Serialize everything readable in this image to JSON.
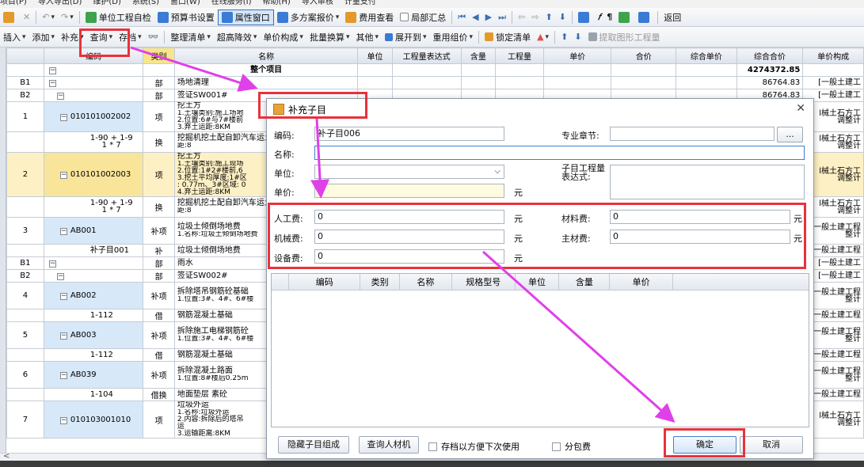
{
  "menubar": [
    "项目(P)",
    "导入导出(D)",
    "维护(D)",
    "系统(S)",
    "窗口(W)",
    "在线服务(I)",
    "帮助(H)",
    "导入审核",
    "计量支付"
  ],
  "toolbar1": [
    {
      "label": "单位工程自检",
      "icon": "check-icon"
    },
    {
      "label": "预算书设置",
      "icon": "settings-icon"
    },
    {
      "label": "属性窗口",
      "icon": "window-icon",
      "active": true
    },
    {
      "label": "多方案报价",
      "icon": "multi-plan-icon",
      "dropdown": true
    },
    {
      "label": "费用查看",
      "icon": "fee-view-icon"
    },
    {
      "label": "局部汇总",
      "icon": "checkbox-icon"
    },
    {
      "label": "返回",
      "icon": "back-icon"
    }
  ],
  "toolbar2": [
    {
      "label": "插入",
      "dropdown": true
    },
    {
      "label": "添加",
      "dropdown": true
    },
    {
      "label": "补充",
      "dropdown": true
    },
    {
      "label": "查询",
      "dropdown": true
    },
    {
      "label": "存档",
      "dropdown": true
    },
    {
      "label": "整理清单",
      "dropdown": true
    },
    {
      "label": "超高降效",
      "dropdown": true
    },
    {
      "label": "单价构成",
      "dropdown": true
    },
    {
      "label": "批量换算",
      "dropdown": true
    },
    {
      "label": "其他",
      "dropdown": true
    },
    {
      "label": "展开到",
      "dropdown": true
    },
    {
      "label": "重用组价",
      "dropdown": true
    },
    {
      "label": "锁定清单",
      "dropdown": false
    },
    {
      "label": "提取图形工程量",
      "dropdown": false
    }
  ],
  "grid": {
    "headers": [
      "编码",
      "类别",
      "名称",
      "单位",
      "工程量表达式",
      "含量",
      "工程量",
      "单价",
      "合价",
      "综合单价",
      "综合合价",
      "单价构成"
    ],
    "rows": [
      {
        "no": "",
        "code": "",
        "type": "",
        "name": "整个项目",
        "total": "4274372.85",
        "comp": "",
        "kind": "root"
      },
      {
        "no": "B1",
        "code": "",
        "type": "部",
        "name": "场地清理",
        "total": "86764.83",
        "comp": "[一般土建工",
        "kind": "part"
      },
      {
        "no": "B2",
        "code": "",
        "type": "部",
        "name": "签证SW001#",
        "total": "86764.83",
        "comp": "[一般土建工",
        "kind": "part"
      },
      {
        "no": "1",
        "code": "010101002002",
        "type": "项",
        "name": "挖土方",
        "desc": "1.土壤类别:施工场地\n2.位置:6#与7#楼前\n3.弃土运距:8KM",
        "total": "",
        "comp": "l械土石方工\n调整计",
        "kind": "item"
      },
      {
        "no": "",
        "code": "1-90 + 1-9\n1 * 7",
        "type": "换",
        "name": "挖掘机挖土配自卸汽车运土",
        "desc": "距:8",
        "total": "",
        "comp": "l械土石方工\n调整计",
        "kind": "sub"
      },
      {
        "no": "2",
        "code": "010101002003",
        "type": "项",
        "name": "挖土方",
        "desc": "1.土壤类别:施工现场\n2.位置:1#2#楼前,6\n3.挖土平均厚度:1#区\n: 0.77m、3#区域: 0\n4.弃土运距:8KM",
        "total": "",
        "comp": "l械土石方工\n调整计",
        "kind": "item-sel"
      },
      {
        "no": "",
        "code": "1-90 + 1-9\n1 * 7",
        "type": "换",
        "name": "挖掘机挖土配自卸汽车运土",
        "desc": "距:8",
        "total": "",
        "comp": "l械土石方工\n调整计",
        "kind": "sub"
      },
      {
        "no": "3",
        "code": "AB001",
        "type": "补项",
        "name": "垃圾土倾倒场地费",
        "desc": "1.名称:垃圾土倾倒场地费",
        "total": "",
        "comp": "一般土建工程\n整计",
        "kind": "item"
      },
      {
        "no": "",
        "code": "补子目001",
        "type": "补",
        "name": "垃圾土倾倒场地费",
        "desc": "",
        "total": "",
        "comp": "一般土建工程",
        "kind": "sub"
      },
      {
        "no": "B1",
        "code": "",
        "type": "部",
        "name": "雨水",
        "total": "",
        "comp": "[一般土建工",
        "kind": "part"
      },
      {
        "no": "B2",
        "code": "",
        "type": "部",
        "name": "签证SW002#",
        "total": "",
        "comp": "[一般土建工",
        "kind": "part"
      },
      {
        "no": "4",
        "code": "AB002",
        "type": "补项",
        "name": "拆除塔吊钢筋砼基础",
        "desc": "1.位置:3#、4#、6#楼",
        "total": "",
        "comp": "一般土建工程\n整计",
        "kind": "item"
      },
      {
        "no": "",
        "code": "1-112",
        "type": "借",
        "name": "钢筋混凝土基础",
        "desc": "",
        "total": "",
        "comp": "一般土建工程",
        "kind": "sub"
      },
      {
        "no": "5",
        "code": "AB003",
        "type": "补项",
        "name": "拆除施工电梯钢筋砼",
        "desc": "1.位置:3#、4#、6#楼",
        "total": "",
        "comp": "一般土建工程\n整计",
        "kind": "item"
      },
      {
        "no": "",
        "code": "1-112",
        "type": "借",
        "name": "钢筋混凝土基础",
        "desc": "",
        "total": "",
        "comp": "一般土建工程",
        "kind": "sub"
      },
      {
        "no": "6",
        "code": "AB039",
        "type": "补项",
        "name": "拆除混凝土路面",
        "desc": "1.位置:8#楼后0.25m",
        "total": "",
        "comp": "一般土建工程\n整计",
        "kind": "item"
      },
      {
        "no": "",
        "code": "1-104",
        "type": "借换",
        "name": "地面垫层 素砼",
        "desc": "",
        "total": "",
        "comp": "一般土建工程",
        "kind": "sub"
      },
      {
        "no": "7",
        "code": "010103001010",
        "type": "项",
        "name": "垃圾外运",
        "desc": "1.名称:垃圾外运\n2.内容:拆除后的塔吊\n运\n3.运输距离:8KM",
        "total": "",
        "comp": "l械土石方工\n调整计",
        "kind": "item"
      }
    ]
  },
  "dialog": {
    "title": "补充子目",
    "code_label": "编码:",
    "code_value": "补子目006",
    "chapter_label": "专业章节:",
    "chapter_value": "",
    "browse_label": "...",
    "name_label": "名称:",
    "name_value": "",
    "unit_label": "单位:",
    "unit_value": "",
    "price_label": "单价:",
    "price_value": "",
    "expr_label": "子目工程量表达式:",
    "labor_label": "人工费:",
    "labor_value": "0",
    "material_label": "材料费:",
    "material_value": "0",
    "machine_label": "机械费:",
    "machine_value": "0",
    "main_material_label": "主材费:",
    "main_material_value": "0",
    "equipment_label": "设备费:",
    "equipment_value": "0",
    "yuan": "元",
    "sub_headers": [
      "编码",
      "类别",
      "名称",
      "规格型号",
      "单位",
      "含量",
      "单价"
    ],
    "hide_button": "隐藏子目组成",
    "query_button": "查询人材机",
    "save_checkbox": "存档以方便下次使用",
    "subcontract_checkbox": "分包费",
    "ok_button": "确定",
    "cancel_button": "取消"
  },
  "colors": {
    "highlight": "#e8323c",
    "arrow": "#e040e8",
    "selection": "#fdf0c4"
  }
}
